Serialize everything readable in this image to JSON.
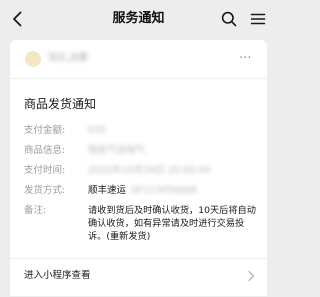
{
  "nav": {
    "title": "服务通知"
  },
  "card": {
    "app_name": "现礼决赛",
    "more_label": "···",
    "notice_title": "商品发货通知",
    "fields": [
      {
        "label": "支付金额:",
        "value": "¥35"
      },
      {
        "label": "商品信息:",
        "value": "微信气泡淘气"
      },
      {
        "label": "支付时间:",
        "value": "2022年10月28日 20:00:04"
      },
      {
        "label": "发货方式:",
        "value": "顺丰速运",
        "extra": "SF123456666"
      },
      {
        "label": "备注:",
        "value": "请收到货后及时确认收货，10天后将自动确认收货，如有异常请及时进行交易投诉。(重新发货)"
      }
    ],
    "footer_label": "进入小程序查看"
  },
  "icons": {
    "back": "chevron-left-icon",
    "search": "search-icon",
    "menu": "hamburger-menu-icon",
    "more": "more-horizontal-icon",
    "chevron": "chevron-right-icon"
  },
  "colors": {
    "background": "#ededed",
    "card": "#ffffff",
    "label": "#9a9a9a",
    "text": "#1a1a1a"
  }
}
